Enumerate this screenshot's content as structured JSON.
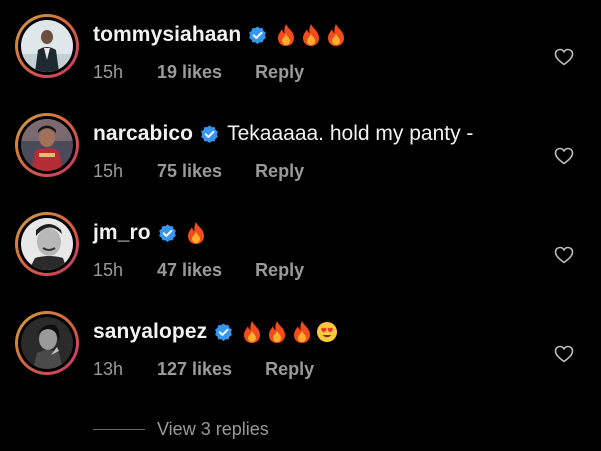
{
  "comments": [
    {
      "username": "tommysiahaan",
      "verified": true,
      "text": "",
      "emojis": [
        "fire",
        "fire",
        "fire"
      ],
      "time": "15h",
      "likes": "19 likes",
      "reply": "Reply"
    },
    {
      "username": "narcabico",
      "verified": true,
      "text": "Tekaaaaa. hold my panty -",
      "emojis": [],
      "time": "15h",
      "likes": "75 likes",
      "reply": "Reply"
    },
    {
      "username": "jm_ro",
      "verified": true,
      "text": "",
      "emojis": [
        "fire"
      ],
      "time": "15h",
      "likes": "47 likes",
      "reply": "Reply"
    },
    {
      "username": "sanyalopez",
      "verified": true,
      "text": "",
      "emojis": [
        "fire",
        "fire",
        "fire",
        "smiling-face-with-heart-eyes"
      ],
      "time": "13h",
      "likes": "127 likes",
      "reply": "Reply"
    }
  ],
  "view_replies": "View 3 replies",
  "colors": {
    "background": "#000000",
    "primary_text": "#f2f2f2",
    "secondary_text": "#9a9a9a",
    "verified_badge": "#3797f0",
    "story_ring": "#d56a3a"
  },
  "icons": {
    "verified": "verified-badge-icon",
    "like": "heart-outline-icon",
    "fire": "fire-emoji",
    "heart_eyes": "smiling-face-with-heart-eyes-emoji"
  }
}
